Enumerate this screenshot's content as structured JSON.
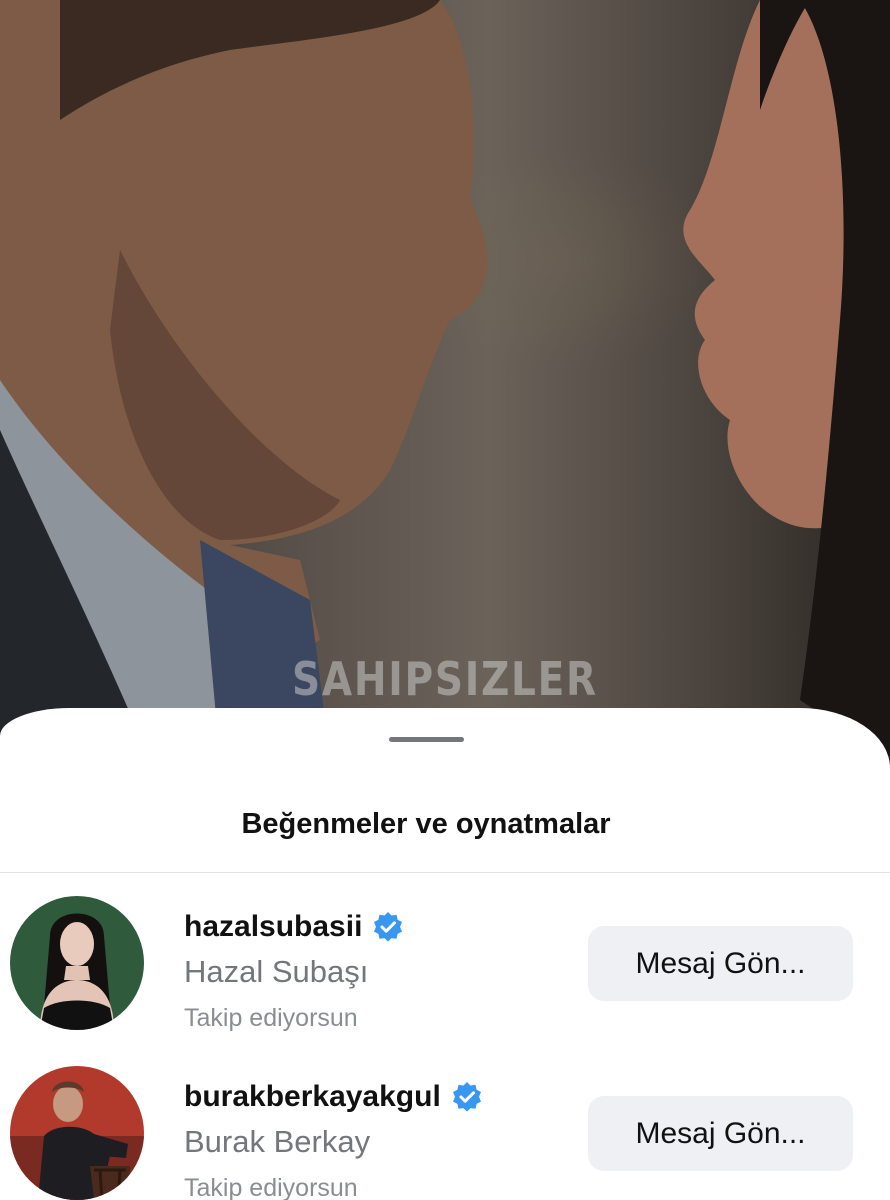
{
  "video": {
    "watermark_text": "SAHIPSIZLER"
  },
  "sheet": {
    "title": "Beğenmeler ve oynatmalar"
  },
  "users": [
    {
      "username": "hazalsubasii",
      "full_name": "Hazal Subaşı",
      "status": "Takip ediyorsun",
      "button_label": "Mesaj Gön...",
      "verified": true,
      "avatar_bg": "#2f5a3c"
    },
    {
      "username": "burakberkayakgul",
      "full_name": "Burak Berkay",
      "status": "Takip ediyorsun",
      "button_label": "Mesaj Gön...",
      "verified": true,
      "avatar_bg": "#b23a2c"
    }
  ],
  "colors": {
    "verified_badge": "#3897f0",
    "button_bg": "#eff0f3",
    "secondary_text": "#73767b"
  }
}
